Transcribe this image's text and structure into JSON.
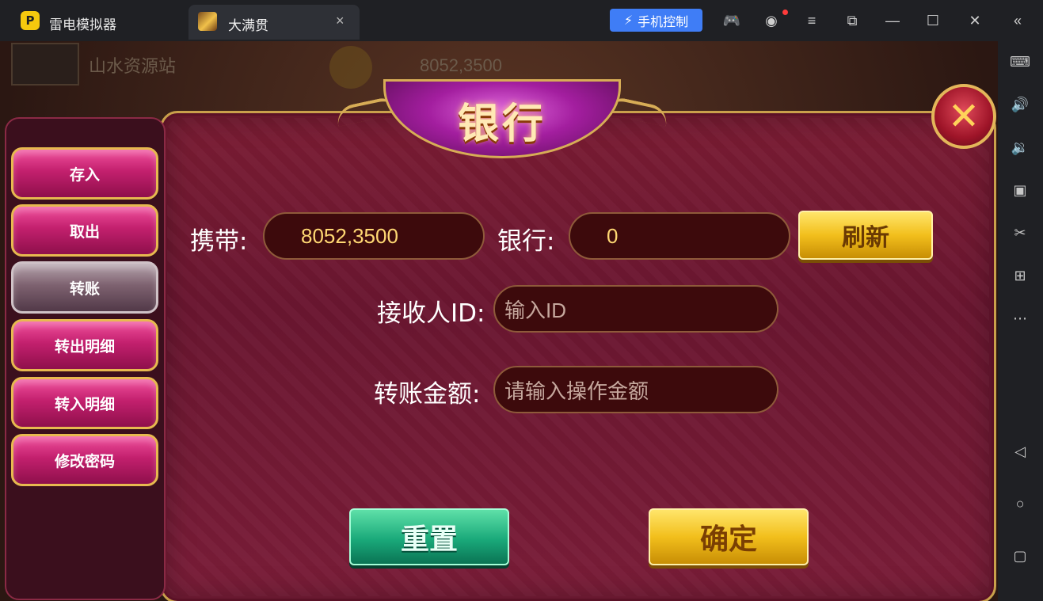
{
  "titlebar": {
    "app_logo": "P",
    "app_name": "雷电模拟器",
    "tab_title": "大满贯",
    "tab_close": "×",
    "phone_control": "手机控制"
  },
  "hud": {
    "player_name": "山水资源站",
    "gold": "8052,3500"
  },
  "modal": {
    "title": "银行",
    "close_glyph": "✕",
    "menu": [
      {
        "label": "存入"
      },
      {
        "label": "取出"
      },
      {
        "label": "转账",
        "active": true
      },
      {
        "label": "转出明细"
      },
      {
        "label": "转入明细"
      },
      {
        "label": "修改密码"
      }
    ],
    "carry_label": "携带:",
    "carry_value": "8052,3500",
    "bank_label": "银行:",
    "bank_value": "0",
    "refresh_label": "刷新",
    "receiver_label": "接收人ID:",
    "receiver_placeholder": "输入ID",
    "amount_label": "转账金额:",
    "amount_placeholder": "请输入操作金额",
    "reset_label": "重置",
    "confirm_label": "确定"
  },
  "icons": {
    "phone_control": "lightning-icon",
    "gamepad": "gamepad-icon",
    "account": "account-icon",
    "menu": "menu-icon",
    "restore": "restore-icon",
    "minimize": "minimize-icon",
    "maximize": "maximize-icon",
    "close": "close-icon",
    "collapse": "collapse-icon"
  },
  "colors": {
    "accent_blue": "#3f7df6",
    "gold": "#f2bf1c",
    "green": "#1aa97a",
    "panel": "#6a1630"
  }
}
